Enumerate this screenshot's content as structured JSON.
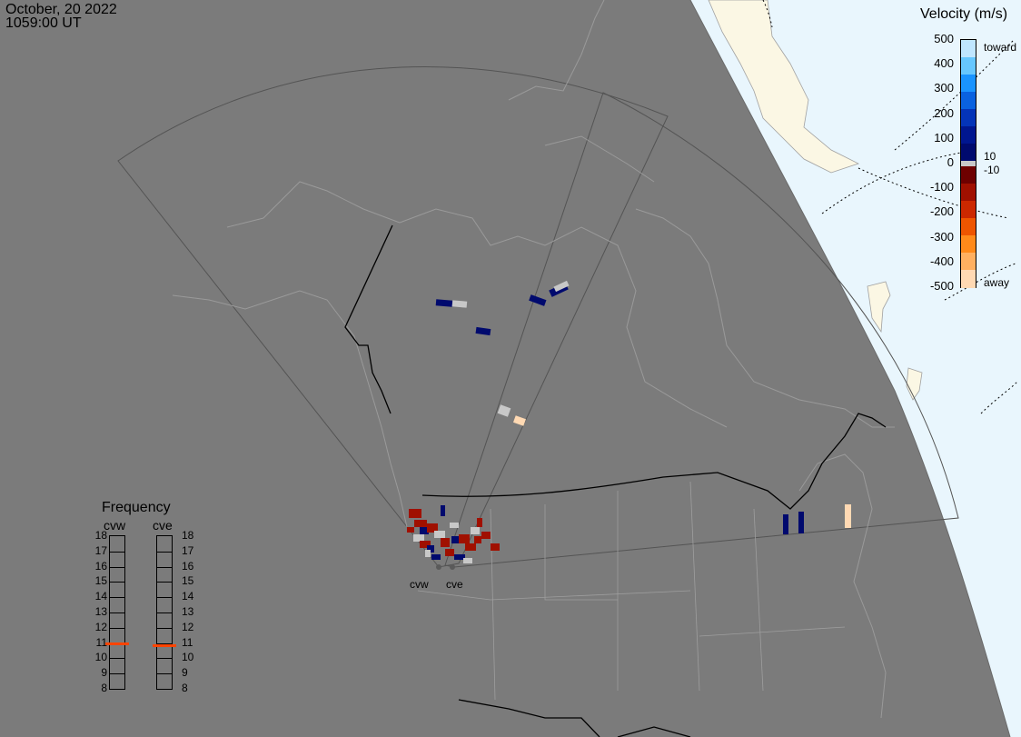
{
  "header": {
    "date": "October, 20 2022",
    "time": "1059:00 UT"
  },
  "velocity_legend": {
    "title": "Velocity (m/s)",
    "ticks": [
      "500",
      "400",
      "300",
      "200",
      "100",
      "0",
      "-100",
      "-200",
      "-300",
      "-400",
      "-500"
    ],
    "inner_labels": [
      "10",
      "-10"
    ],
    "toward_label": "toward",
    "away_label": "away",
    "colors_toward": [
      "#bfe6ff",
      "#66c7ff",
      "#1a94ff",
      "#0a62e0",
      "#0434b8",
      "#00168f",
      "#000a6e"
    ],
    "colors_away": [
      "#6e0000",
      "#a01000",
      "#cc2800",
      "#ee5500",
      "#ff8a1a",
      "#ffb060",
      "#ffd9b3"
    ]
  },
  "frequency_legend": {
    "title": "Frequency",
    "radars": [
      "cvw",
      "cve"
    ],
    "scale": [
      "18",
      "17",
      "16",
      "15",
      "14",
      "13",
      "12",
      "11",
      "10",
      "9",
      "8"
    ],
    "cvw_freq_mhz": 10.9,
    "cve_freq_mhz": 10.8
  },
  "radar_sites": [
    "cvw",
    "cve"
  ],
  "colors": {
    "land": "#7b7b7b",
    "daylight": "#e9f6fd",
    "daylight_land": "#fbf7e4",
    "coast": "#9e9e9e",
    "border": "#000000"
  }
}
